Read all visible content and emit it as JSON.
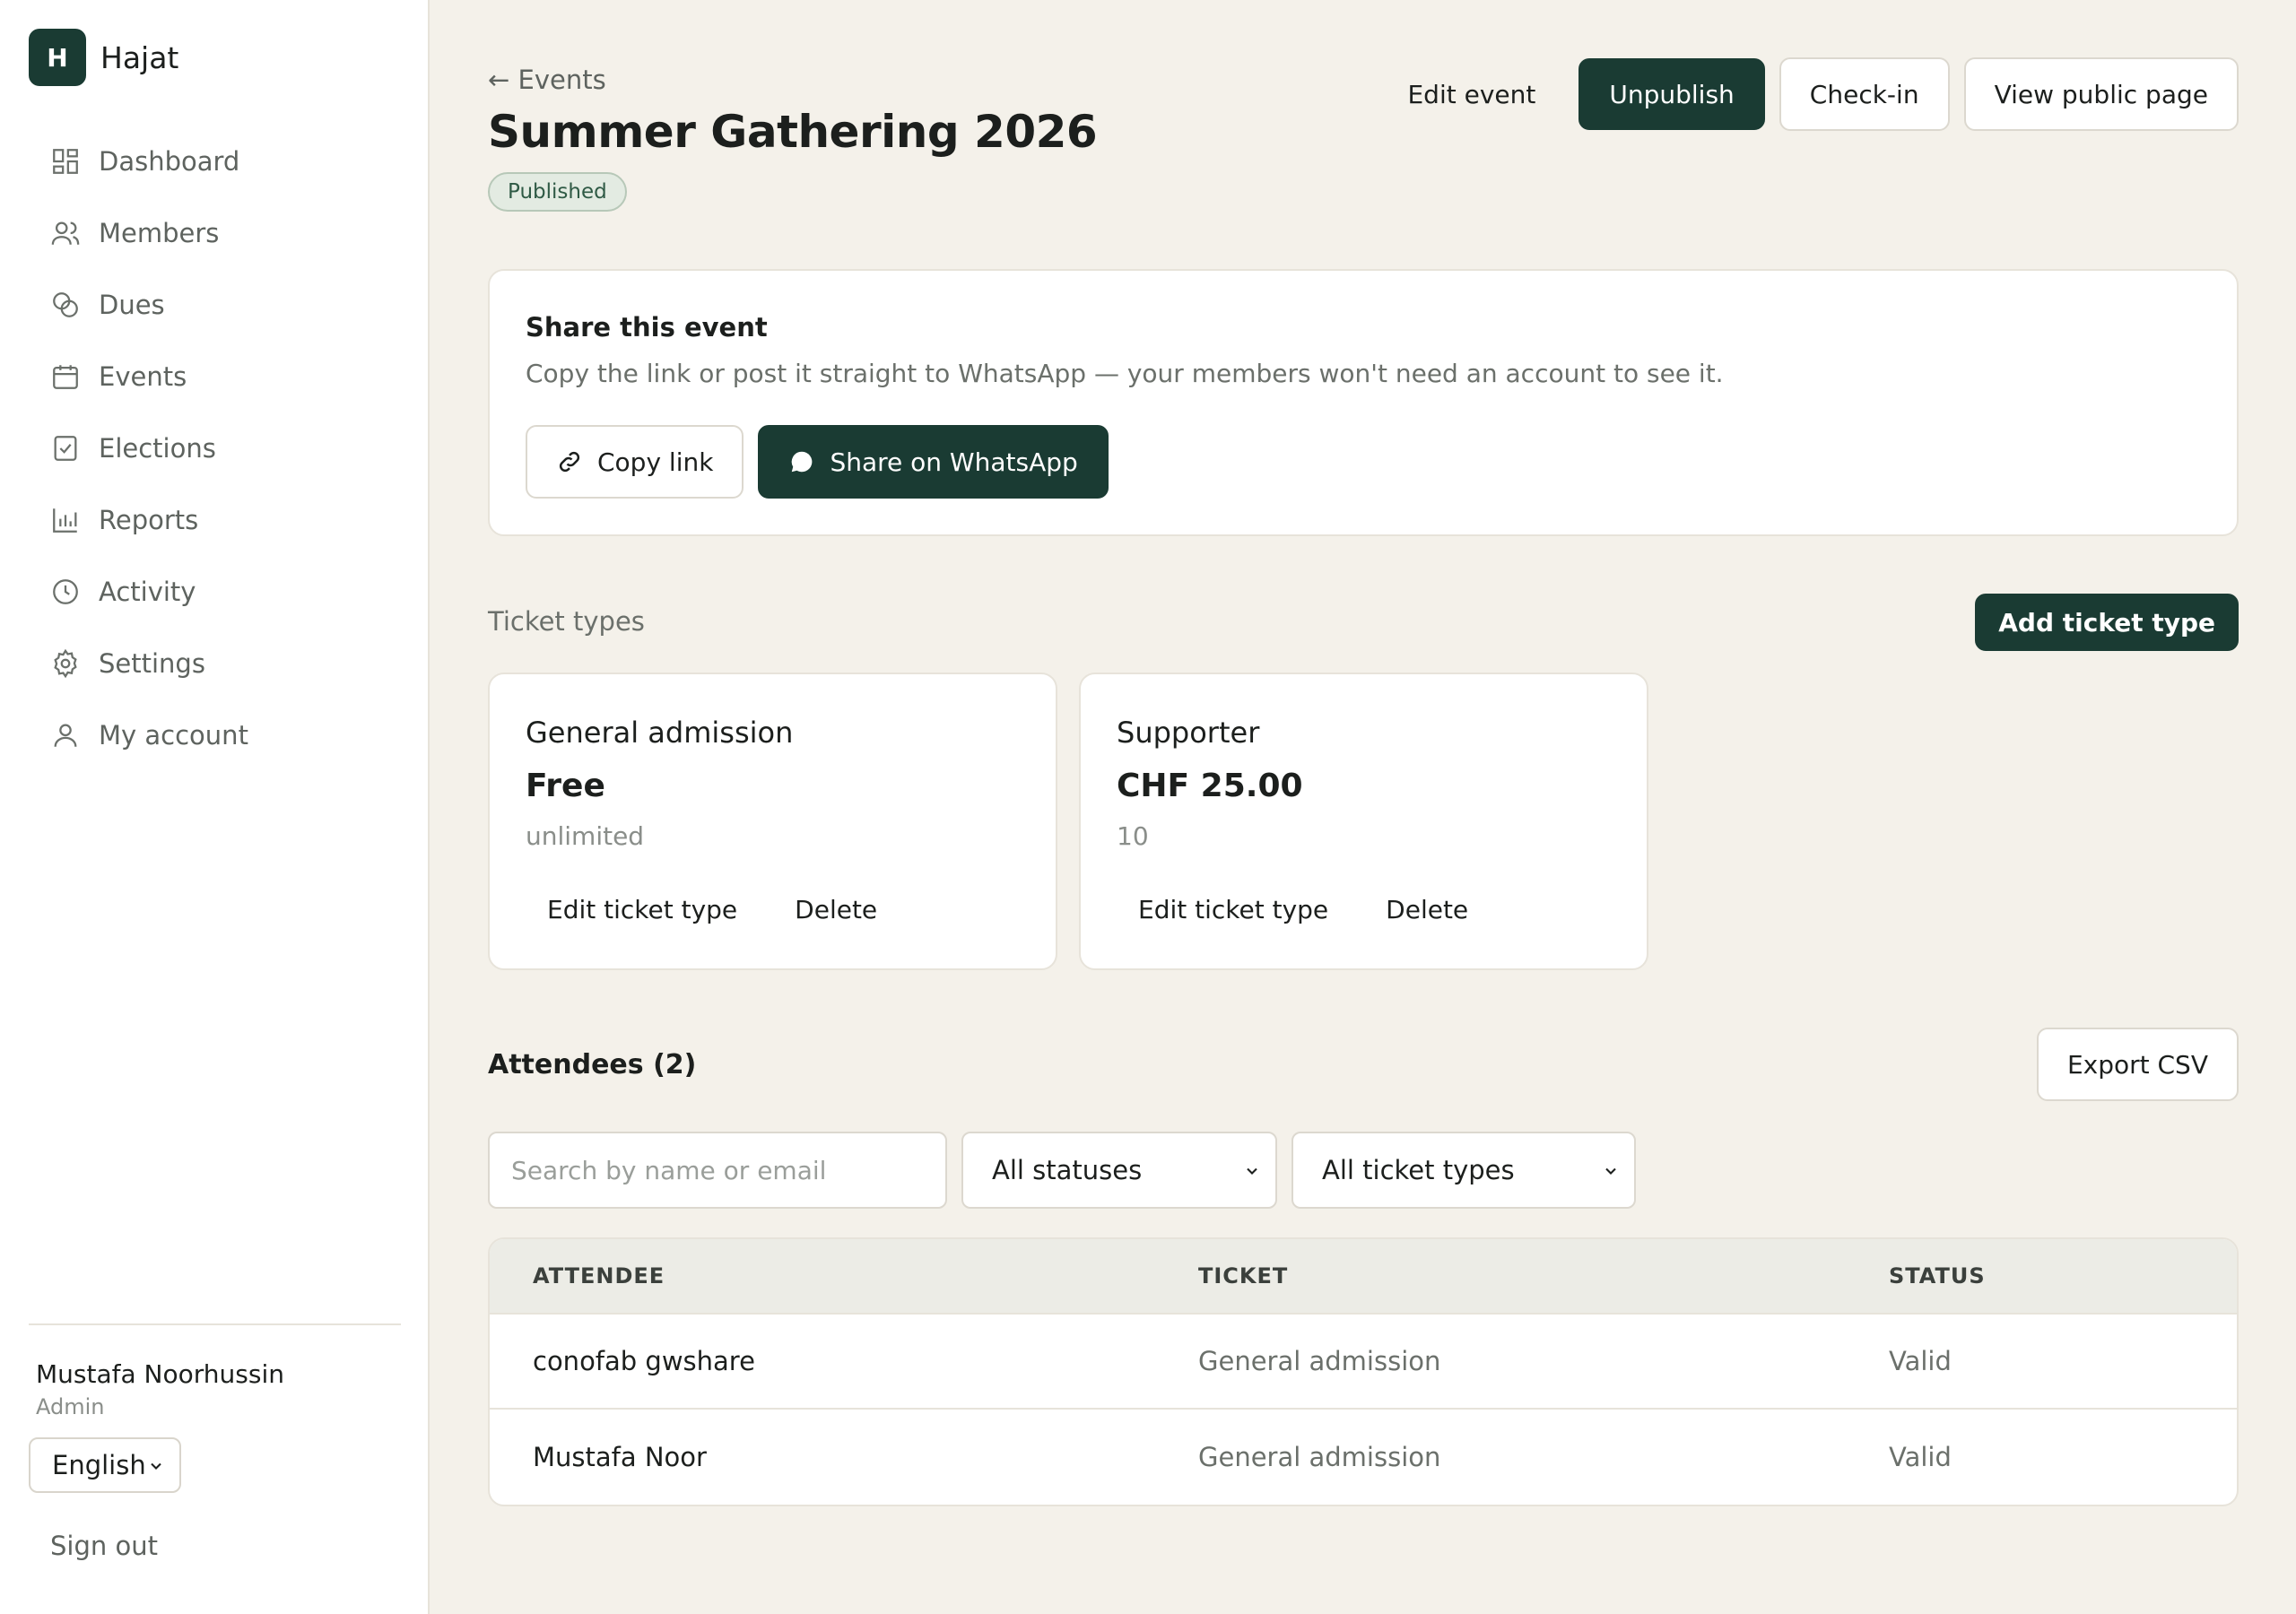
{
  "brand": {
    "logo_letter": "H",
    "name": "Hajat"
  },
  "sidebar": {
    "items": [
      {
        "label": "Dashboard",
        "icon": "dashboard-icon"
      },
      {
        "label": "Members",
        "icon": "members-icon"
      },
      {
        "label": "Dues",
        "icon": "dues-icon"
      },
      {
        "label": "Events",
        "icon": "calendar-icon"
      },
      {
        "label": "Elections",
        "icon": "ballot-icon"
      },
      {
        "label": "Reports",
        "icon": "bar-chart-icon"
      },
      {
        "label": "Activity",
        "icon": "clock-icon"
      },
      {
        "label": "Settings",
        "icon": "gear-icon"
      },
      {
        "label": "My account",
        "icon": "user-icon"
      }
    ],
    "user": {
      "name": "Mustafa Noorhussin",
      "role": "Admin"
    },
    "language": "English",
    "signout": "Sign out"
  },
  "header": {
    "back": "← Events",
    "title": "Summer Gathering 2026",
    "status": "Published",
    "actions": {
      "edit": "Edit event",
      "unpublish": "Unpublish",
      "checkin": "Check-in",
      "view_public": "View public page"
    }
  },
  "share": {
    "title": "Share this event",
    "description": "Copy the link or post it straight to WhatsApp — your members won't need an account to see it.",
    "copy_link": "Copy link",
    "whatsapp": "Share on WhatsApp"
  },
  "tickets": {
    "section_label": "Ticket types",
    "add_button": "Add ticket type",
    "items": [
      {
        "name": "General admission",
        "price": "Free",
        "capacity": "unlimited",
        "edit": "Edit ticket type",
        "delete": "Delete"
      },
      {
        "name": "Supporter",
        "price": "CHF 25.00",
        "capacity": "10",
        "edit": "Edit ticket type",
        "delete": "Delete"
      }
    ]
  },
  "attendees": {
    "title": "Attendees (2)",
    "export": "Export CSV",
    "search_placeholder": "Search by name or email",
    "status_filter": "All statuses",
    "ticket_filter": "All ticket types",
    "columns": [
      "ATTENDEE",
      "TICKET",
      "STATUS"
    ],
    "rows": [
      {
        "name": "conofab gwshare",
        "ticket": "General admission",
        "status": "Valid"
      },
      {
        "name": "Mustafa Noor",
        "ticket": "General admission",
        "status": "Valid"
      }
    ]
  },
  "colors": {
    "primary": "#1a3b33",
    "background": "#f4f1ea",
    "badge_bg": "#e3ebe2"
  }
}
